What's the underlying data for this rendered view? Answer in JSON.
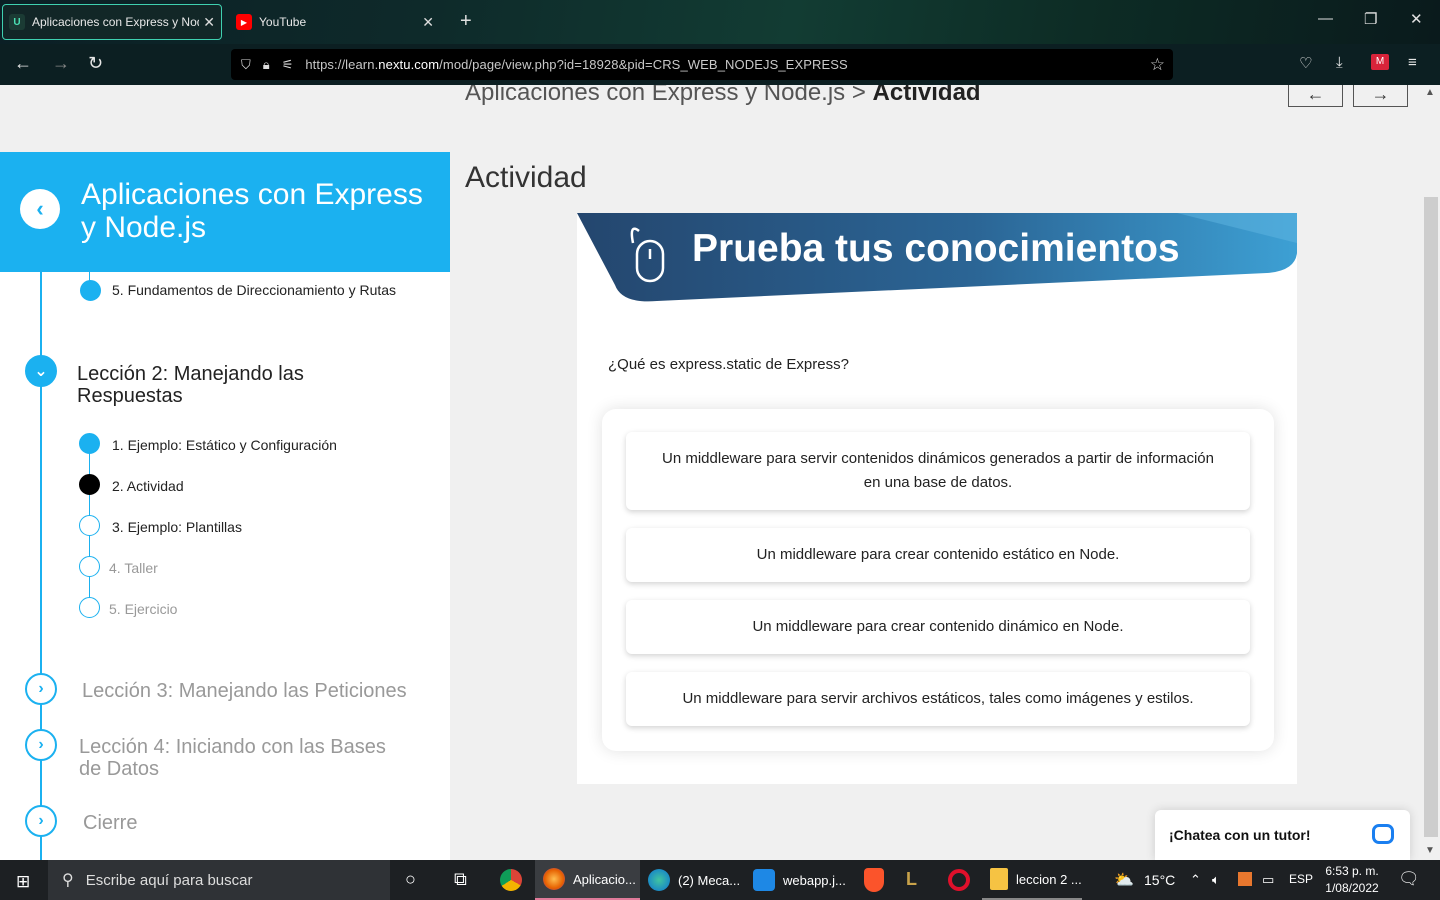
{
  "browser": {
    "tabs": [
      {
        "title": "Aplicaciones con Express y Node",
        "favicon": "U",
        "active": true
      },
      {
        "title": "YouTube",
        "active": false
      }
    ],
    "url_prefix": "https://learn.",
    "url_domain": "nextu.com",
    "url_rest": "/mod/page/view.php?id=18928&pid=CRS_WEB_NODEJS_EXPRESS"
  },
  "page": {
    "breadcrumb_parent": "Aplicaciones con Express y Node.js",
    "breadcrumb_sep": ">",
    "breadcrumb_current": "Actividad",
    "prev_arrow": "←",
    "next_arrow": "→"
  },
  "sidebar": {
    "course_title": "Aplicaciones con Express y Node.js",
    "top_item": "5. Fundamentos de Direccionamiento y Rutas",
    "lesson2": {
      "title": "Lección 2: Manejando las Respuestas",
      "items": [
        {
          "label": "1. Ejemplo: Estático y Configuración",
          "state": "done"
        },
        {
          "label": "2. Actividad",
          "state": "current"
        },
        {
          "label": "3. Ejemplo: Plantillas",
          "state": "open"
        },
        {
          "label": "4. Taller",
          "state": "locked"
        },
        {
          "label": "5. Ejercicio",
          "state": "locked"
        }
      ]
    },
    "lessons_after": [
      {
        "title": "Lección 3: Manejando las Peticiones"
      },
      {
        "title": "Lección 4: Iniciando con las Bases de Datos"
      },
      {
        "title": "Cierre"
      }
    ]
  },
  "content": {
    "title": "Actividad",
    "banner_text": "Prueba tus conocimientos",
    "question": "¿Qué es express.static de Express?",
    "options": [
      "Un middleware para servir contenidos dinámicos generados a partir de información en una base de datos.",
      "Un middleware para crear contenido estático en Node.",
      "Un middleware para crear contenido dinámico en Node.",
      "Un middleware para servir archivos estáticos, tales como imágenes y estilos."
    ]
  },
  "chat": {
    "label": "¡Chatea con un tutor!"
  },
  "taskbar": {
    "search_placeholder": "Escribe aquí para buscar",
    "apps": [
      "Aplicacio...",
      "(2) Meca...",
      "webapp.j...",
      "leccion 2 ..."
    ],
    "temperature": "15°C",
    "language": "ESP",
    "time": "6:53 p. m.",
    "date": "1/08/2022"
  },
  "colors": {
    "accent": "#1bb1f0",
    "banner": "#2b5a84",
    "tab_border": "#3fd0b0"
  }
}
